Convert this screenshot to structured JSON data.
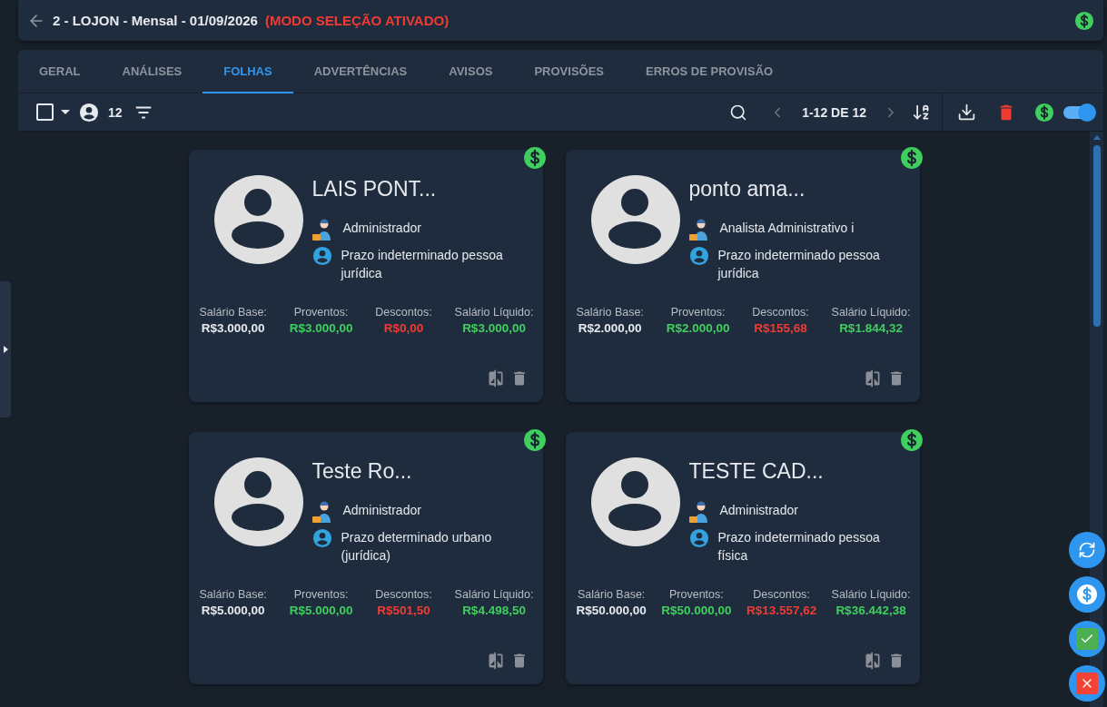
{
  "header": {
    "title": "2 - LOJON - Mensal - 01/09/2026",
    "mode": "(MODO SELEÇÃO ATIVADO)"
  },
  "tabs": [
    {
      "label": "GERAL",
      "selected": false
    },
    {
      "label": "ANÁLISES",
      "selected": false
    },
    {
      "label": "FOLHAS",
      "selected": true
    },
    {
      "label": "ADVERTÊNCIAS",
      "selected": false
    },
    {
      "label": "AVISOS",
      "selected": false
    },
    {
      "label": "PROVISÕES",
      "selected": false
    },
    {
      "label": "ERROS DE PROVISÃO",
      "selected": false
    }
  ],
  "toolbar": {
    "select_all": {
      "checked": false
    },
    "count": "12",
    "pagination": "1-12 DE 12",
    "toggle": {
      "on": true
    }
  },
  "cards": [
    {
      "name": "LAIS PONT...",
      "role": "Administrador",
      "contract": "Prazo indeterminado pessoa jurídica",
      "values": [
        {
          "kind": "base",
          "label": "Salário Base:",
          "value": "R$3.000,00"
        },
        {
          "kind": "earnings",
          "label": "Proventos:",
          "value": "R$3.000,00"
        },
        {
          "kind": "deductions",
          "label": "Descontos:",
          "value": "R$0,00"
        },
        {
          "kind": "net",
          "label": "Salário Líquido:",
          "value": "R$3.000,00"
        }
      ]
    },
    {
      "name": "ponto ama...",
      "role": "Analista Administrativo i",
      "contract": "Prazo indeterminado pessoa jurídica",
      "values": [
        {
          "kind": "base",
          "label": "Salário Base:",
          "value": "R$2.000,00"
        },
        {
          "kind": "earnings",
          "label": "Proventos:",
          "value": "R$2.000,00"
        },
        {
          "kind": "deductions",
          "label": "Descontos:",
          "value": "R$155,68"
        },
        {
          "kind": "net",
          "label": "Salário Líquido:",
          "value": "R$1.844,32"
        }
      ]
    },
    {
      "name": "Teste Ro...",
      "role": "Administrador",
      "contract": "Prazo determinado urbano (jurídica)",
      "values": [
        {
          "kind": "base",
          "label": "Salário Base:",
          "value": "R$5.000,00"
        },
        {
          "kind": "earnings",
          "label": "Proventos:",
          "value": "R$5.000,00"
        },
        {
          "kind": "deductions",
          "label": "Descontos:",
          "value": "R$501,50"
        },
        {
          "kind": "net",
          "label": "Salário Líquido:",
          "value": "R$4.498,50"
        }
      ]
    },
    {
      "name": "TESTE CAD...",
      "role": "Administrador",
      "contract": "Prazo indeterminado pessoa física",
      "values": [
        {
          "kind": "base",
          "label": "Salário Base:",
          "value": "R$50.000,00"
        },
        {
          "kind": "earnings",
          "label": "Proventos:",
          "value": "R$50.000,00"
        },
        {
          "kind": "deductions",
          "label": "Descontos:",
          "value": "R$13.557,62"
        },
        {
          "kind": "net",
          "label": "Salário Líquido:",
          "value": "R$36.442,38"
        }
      ]
    }
  ]
}
